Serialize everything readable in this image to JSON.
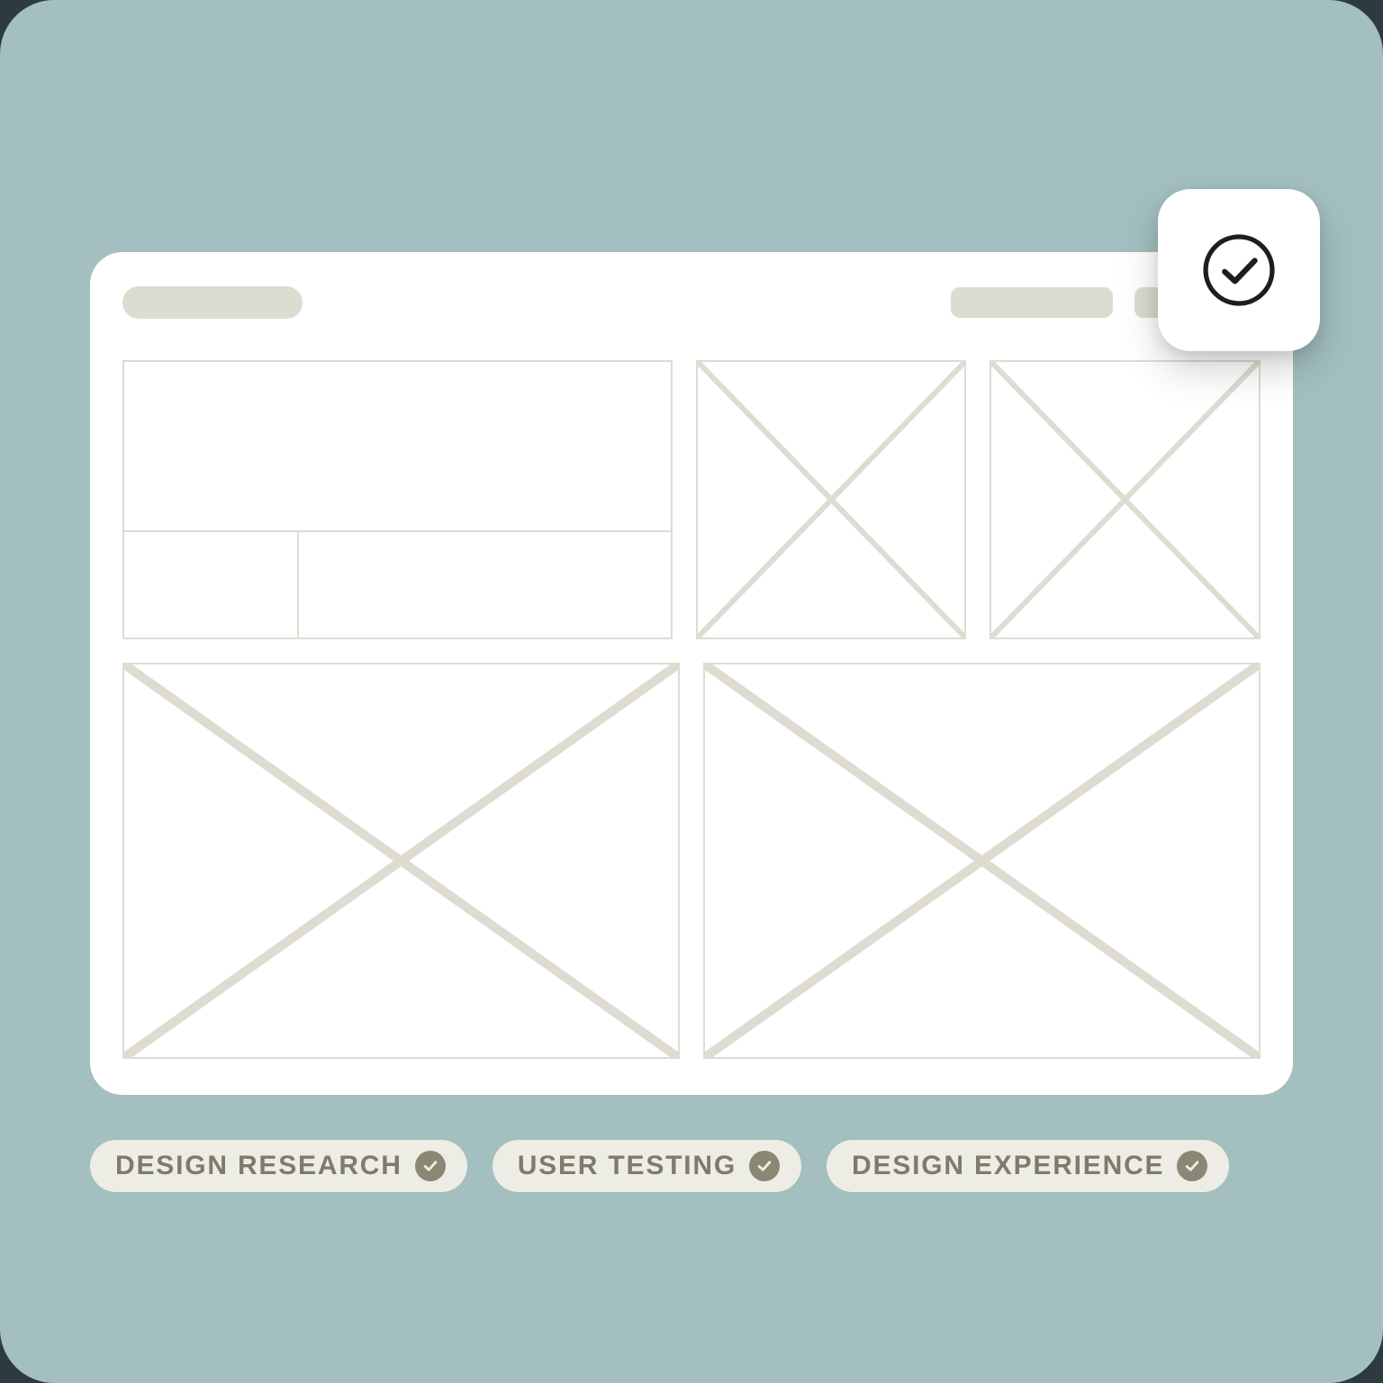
{
  "colors": {
    "canvas_bg": "#a3bfbf",
    "outer_bg": "#2d3b3f",
    "window_bg": "#ffffff",
    "wire_stroke": "#dedcd1",
    "placeholder_fill": "#dddcd0",
    "chip_bg": "#eeede5",
    "chip_text": "#7e7b6a",
    "chip_check_bg": "#8a8774",
    "badge_stroke": "#1e1e1e"
  },
  "chips": [
    {
      "label": "DESIGN RESEARCH",
      "checked": true
    },
    {
      "label": "USER TESTING",
      "checked": true
    },
    {
      "label": "DESIGN EXPERIENCE",
      "checked": true
    }
  ],
  "badge": {
    "icon": "check-circle",
    "state": "complete"
  }
}
